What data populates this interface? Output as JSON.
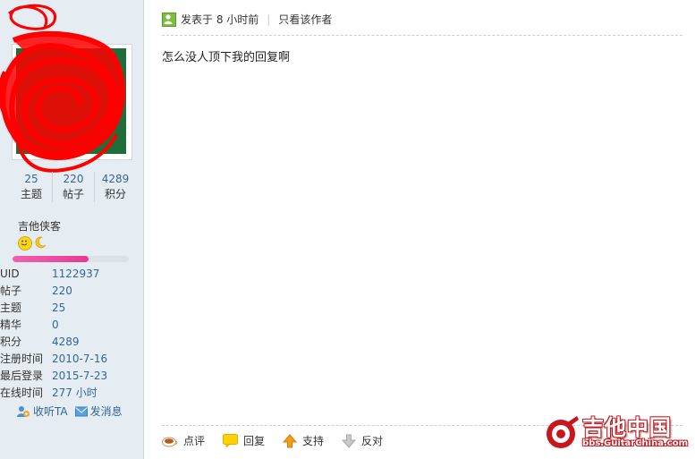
{
  "author": {
    "stats": [
      {
        "value": "25",
        "label": "主题"
      },
      {
        "value": "220",
        "label": "帖子"
      },
      {
        "value": "4289",
        "label": "积分"
      }
    ],
    "rank": "吉他侠客",
    "level_progress": 0.65,
    "info": [
      {
        "key": "UID",
        "value": "1122937"
      },
      {
        "key": "帖子",
        "value": "220"
      },
      {
        "key": "主题",
        "value": "25"
      },
      {
        "key": "精华",
        "value": "0"
      },
      {
        "key": "积分",
        "value": "4289"
      },
      {
        "key": "注册时间",
        "value": "2010-7-16"
      },
      {
        "key": "最后登录",
        "value": "2015-7-23"
      },
      {
        "key": "在线时间",
        "value": "277 小时"
      }
    ],
    "follow_label": "收听TA",
    "message_label": "发消息"
  },
  "post": {
    "posted_label": "发表于 8 小时前",
    "only_author_label": "只看该作者",
    "content": "怎么没人顶下我的回复啊",
    "actions": {
      "comment": "点评",
      "reply": "回复",
      "support": "支持",
      "oppose": "反对"
    }
  },
  "watermark": {
    "title": "吉他中国",
    "site": "bbs.GuitarChina.com"
  },
  "colors": {
    "sidebar_bg": "#e5edf2",
    "link": "#336699",
    "progress": "#e63a93",
    "scribble": "#ff0000"
  }
}
